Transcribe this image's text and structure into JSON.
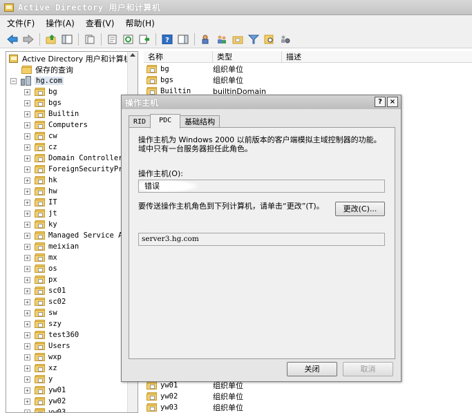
{
  "window": {
    "title": "Active Directory 用户和计算机"
  },
  "menu": [
    "文件(F)",
    "操作(A)",
    "查看(V)",
    "帮助(H)"
  ],
  "toolbar": {
    "icons": [
      "back-icon",
      "forward-icon",
      "up-folder-icon",
      "show-hide-tree-icon",
      "copy-icon",
      "properties-icon",
      "refresh-icon",
      "export-list-icon",
      "help-icon",
      "action-pane-icon",
      "user-icon",
      "group-icon",
      "ou-icon",
      "filter-icon",
      "find-icon",
      "delegate-icon"
    ]
  },
  "tree": {
    "root": "Active Directory 用户和计算机",
    "saved_queries": "保存的查询",
    "domain": "hg.com",
    "items": [
      "bg",
      "bgs",
      "Builtin",
      "Computers",
      "cw",
      "cz",
      "Domain Controllers",
      "ForeignSecurityPrincipals",
      "hk",
      "hw",
      "IT",
      "jt",
      "ky",
      "Managed Service Accounts",
      "meixian",
      "mx",
      "os",
      "px",
      "sc01",
      "sc02",
      "sw",
      "szy",
      "test360",
      "Users",
      "wxp",
      "xz",
      "y",
      "yw01",
      "yw02",
      "yw03"
    ]
  },
  "list": {
    "columns": [
      "名称",
      "类型",
      "描述"
    ],
    "rows_top": [
      {
        "name": "bg",
        "type": "组织单位"
      },
      {
        "name": "bgs",
        "type": "组织单位"
      },
      {
        "name": "Builtin",
        "type": "builtinDomain"
      }
    ],
    "rows_bottom": [
      {
        "name": "yw01",
        "type": "组织单位"
      },
      {
        "name": "yw02",
        "type": "组织单位"
      },
      {
        "name": "yw03",
        "type": "组织单位"
      }
    ]
  },
  "dialog": {
    "title": "操作主机",
    "help_btn": "?",
    "close_btn": "×",
    "tabs": [
      "RID",
      "PDC",
      "基础结构"
    ],
    "active_tab": "PDC",
    "description": "操作主机为 Windows 2000 以前版本的客户端模拟主域控制器的功能。域中只有一台服务器担任此角色。",
    "operations_master_label": "操作主机(O):",
    "operations_master_value": "错误",
    "transfer_text": "要传送操作主机角色到下列计算机，请单击“更改”(T)。",
    "change_button": "更改(C)...",
    "target_computer": "server3.hg.com",
    "close_button": "关闭",
    "cancel_button": "取消"
  }
}
